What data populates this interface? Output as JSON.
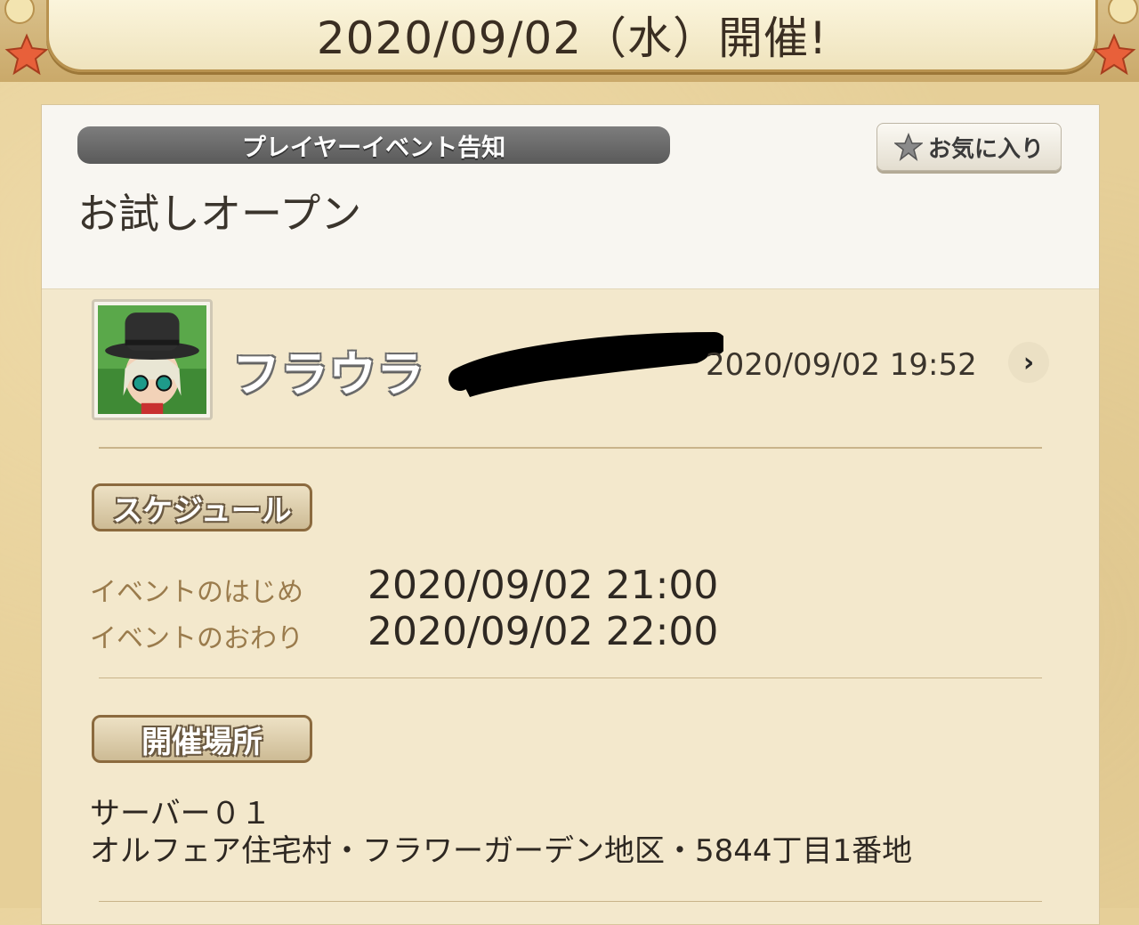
{
  "banner": {
    "title": "2020/09/02（水）開催!"
  },
  "event": {
    "category": "プレイヤーイベント告知",
    "favorite_label": "お気に入り",
    "title": "お試しオープン"
  },
  "poster": {
    "name": "フラウラ",
    "posted_at": "2020/09/02  19:52",
    "chevron": "›"
  },
  "schedule": {
    "label": "スケジュール",
    "start_label": "イベントのはじめ",
    "start_value": "2020/09/02  21:00",
    "end_label": "イベントのおわり",
    "end_value": "2020/09/02  22:00"
  },
  "venue": {
    "label": "開催場所",
    "server": "サーバー０１",
    "address": "オルフェア住宅村・フラワーガーデン地区・5844丁目1番地"
  },
  "icons": {
    "favorite": "star-icon",
    "detail": "chevron-right-icon"
  },
  "colors": {
    "category_bar": "#6a6a6a",
    "section_label_border": "#8b6a3e",
    "schedule_label_text": "#9a7b4c"
  }
}
